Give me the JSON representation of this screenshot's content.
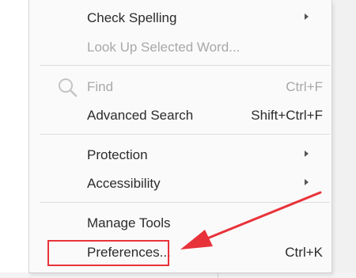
{
  "menu": {
    "items": [
      {
        "label": "Check Spelling",
        "shortcut": "",
        "submenu": true,
        "disabled": false
      },
      {
        "label": "Look Up Selected Word...",
        "shortcut": "",
        "submenu": false,
        "disabled": true
      },
      {
        "label": "Find",
        "shortcut": "Ctrl+F",
        "submenu": false,
        "disabled": true,
        "icon": "search-icon"
      },
      {
        "label": "Advanced Search",
        "shortcut": "Shift+Ctrl+F",
        "submenu": false,
        "disabled": false
      },
      {
        "label": "Protection",
        "shortcut": "",
        "submenu": true,
        "disabled": false
      },
      {
        "label": "Accessibility",
        "shortcut": "",
        "submenu": true,
        "disabled": false
      },
      {
        "label": "Manage Tools",
        "shortcut": "",
        "submenu": false,
        "disabled": false
      },
      {
        "label": "Preferences...",
        "shortcut": "Ctrl+K",
        "submenu": false,
        "disabled": false
      }
    ]
  },
  "annotation": {
    "highlight_color": "#e8323a",
    "highlighted_item": "Preferences..."
  }
}
